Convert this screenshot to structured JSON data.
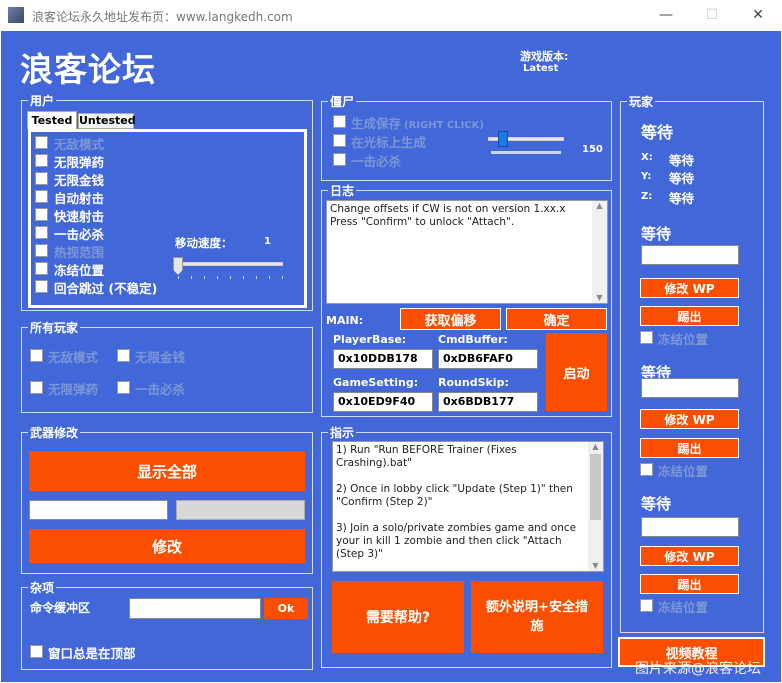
{
  "window": {
    "title": "浪客论坛永久地址发布页：www.langkedh.com",
    "minimize_glyph": "—",
    "maximize_glyph": "☐",
    "close_glyph": "✕"
  },
  "header": {
    "app_title": "浪客论坛",
    "version_label": "游戏版本:",
    "version_value": "Latest"
  },
  "user": {
    "title": "用户",
    "tabs": [
      "Tested",
      "Untested"
    ],
    "items": [
      {
        "label": "无敌模式",
        "enabled": false
      },
      {
        "label": "无限弹药",
        "enabled": true
      },
      {
        "label": "无限金钱",
        "enabled": true
      },
      {
        "label": "自动射击",
        "enabled": true
      },
      {
        "label": "快速射击",
        "enabled": true
      },
      {
        "label": "一击必杀",
        "enabled": true
      },
      {
        "label": "热视范围",
        "enabled": false
      },
      {
        "label": "冻结位置",
        "enabled": true
      },
      {
        "label": "回合跳过 (不稳定)",
        "enabled": true
      }
    ],
    "move_speed_label": "移动速度：",
    "move_speed_value": "1"
  },
  "all_players": {
    "title": "所有玩家",
    "items": [
      "无敌模式",
      "无限金钱",
      "无限弹药",
      "一击必杀"
    ]
  },
  "weapon": {
    "title": "武器修改",
    "show_all": "显示全部",
    "modify": "修改"
  },
  "misc": {
    "title": "杂项",
    "cmd_label": "命令缓冲区",
    "ok": "Ok",
    "always_on_top": "窗口总是在顶部"
  },
  "zombie": {
    "title": "僵尸",
    "items": [
      {
        "label": "生成保存",
        "hint": "(RIGHT CLICK)"
      },
      {
        "label": "在光标上生成",
        "hint": ""
      },
      {
        "label": "一击必杀",
        "hint": ""
      }
    ],
    "slider_value": "150",
    "slider_level": 0.2
  },
  "log": {
    "title": "日志",
    "lines": [
      "Change offsets if CW is not on version 1.xx.x",
      "Press \"Confirm\" to unlock \"Attach\"."
    ]
  },
  "main": {
    "label": "MAIN:",
    "get_offsets": "获取偏移",
    "confirm": "确定",
    "start": "启动",
    "fields": [
      {
        "label": "PlayerBase:",
        "value": "0x10DDB178"
      },
      {
        "label": "CmdBuffer:",
        "value": "0xDB6FAF0"
      },
      {
        "label": "GameSetting:",
        "value": "0x10ED9F40"
      },
      {
        "label": "RoundSkip:",
        "value": "0x6BDB177"
      }
    ]
  },
  "guide": {
    "title": "指示",
    "paragraphs": [
      "1) Run \"Run BEFORE Trainer (Fixes Crashing).bat\"",
      "2) Once in lobby click \"Update (Step 1)\" then \"Confirm (Step 2)\"",
      "3) Join a solo/private zombies game and once your in kill 1 zombie and then click \"Attach (Step 3)\""
    ],
    "help": "需要帮助?",
    "extra": "额外说明+安全措施"
  },
  "players": {
    "title": "玩家",
    "waiting": "等待",
    "x": "X:",
    "y": "Y:",
    "z": "Z:",
    "modify_wp": "修改 WP",
    "kick": "踢出",
    "freeze": "冻结位置",
    "video": "视频教程"
  },
  "watermark": "图片来源@浪客论坛"
}
